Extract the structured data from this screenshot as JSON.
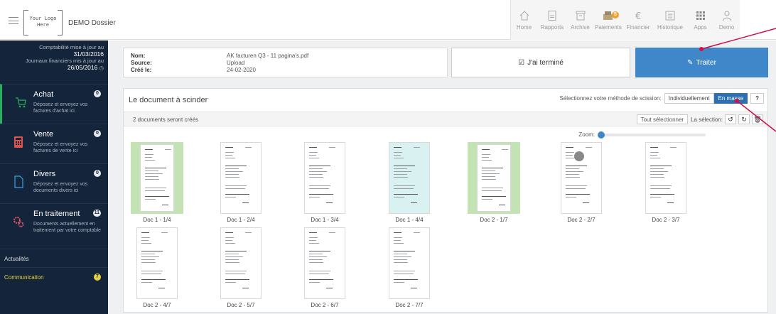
{
  "header": {
    "logo_line1": "Your Logo",
    "logo_line2": "Here",
    "dossier": "DEMO Dossier",
    "nav": [
      {
        "label": "Home",
        "icon": "home-icon"
      },
      {
        "label": "Rapports",
        "icon": "report-icon"
      },
      {
        "label": "Archive",
        "icon": "archive-icon"
      },
      {
        "label": "Paiements",
        "icon": "payments-icon",
        "badge": "5"
      },
      {
        "label": "Financier",
        "icon": "euro-icon"
      },
      {
        "label": "Historique",
        "icon": "history-icon"
      },
      {
        "label": "Apps",
        "icon": "apps-icon"
      },
      {
        "label": "Demo",
        "icon": "user-icon"
      }
    ]
  },
  "sidebar": {
    "compta_label": "Comptabilité mise à jour au",
    "compta_date": "31/03/2016",
    "journaux_label": "Journaux financiers mis à jour au",
    "journaux_date": "26/05/2016",
    "items": [
      {
        "title": "Achat",
        "desc": "Déposez et envoyez vos factures d'achat ici",
        "badge": "0"
      },
      {
        "title": "Vente",
        "desc": "Déposez et envoyez vos factures de vente ici",
        "badge": "0"
      },
      {
        "title": "Divers",
        "desc": "Déposez et envoyez vos documents divers ici",
        "badge": "0"
      },
      {
        "title": "En traitement",
        "desc": "Documents actuellement en traitement par votre comptable",
        "badge": "11"
      }
    ],
    "actualites": "Actualités",
    "communication": "Communication",
    "communication_badge": "7"
  },
  "document": {
    "nom_label": "Nom:",
    "nom_value": "AK facturen Q3 - 11 pagina's.pdf",
    "source_label": "Source:",
    "source_value": "Upload",
    "cree_label": "Créé le:",
    "cree_value": "24-02-2020",
    "done_label": "J'ai terminé",
    "traiter_label": "Traiter"
  },
  "splitter": {
    "title": "Le document à scinder",
    "method_label": "Sélectionnez votre méthode de scission:",
    "method_individual": "Individuellement",
    "method_bulk": "En masse",
    "help": "?",
    "count_text": "2 documents seront créés",
    "select_all": "Tout sélectionner",
    "selection_label": "La sélection:",
    "zoom_label": "Zoom:",
    "zoom_level": 0,
    "pages": [
      {
        "label": "Doc 1 - 1/4",
        "selected": true,
        "tint": false
      },
      {
        "label": "Doc 1 - 2/4",
        "selected": false,
        "tint": false
      },
      {
        "label": "Doc 1 - 3/4",
        "selected": false,
        "tint": false
      },
      {
        "label": "Doc 1 - 4/4",
        "selected": false,
        "tint": true
      },
      {
        "label": "Doc 2 - 1/7",
        "selected": true,
        "tint": false
      },
      {
        "label": "Doc 2 - 2/7",
        "selected": false,
        "tint": false
      },
      {
        "label": "Doc 2 - 3/7",
        "selected": false,
        "tint": false
      },
      {
        "label": "Doc 2 - 4/7",
        "selected": false,
        "tint": false
      },
      {
        "label": "Doc 2 - 5/7",
        "selected": false,
        "tint": false
      },
      {
        "label": "Doc 2 - 6/7",
        "selected": false,
        "tint": false
      },
      {
        "label": "Doc 2 - 7/7",
        "selected": false,
        "tint": false
      }
    ]
  },
  "colors": {
    "sidebar_bg": "#13243b",
    "accent_blue": "#3f87c8",
    "selected_green": "#c3e3b4",
    "active_green": "#2ab05d",
    "annotation_red": "#d0114a"
  }
}
